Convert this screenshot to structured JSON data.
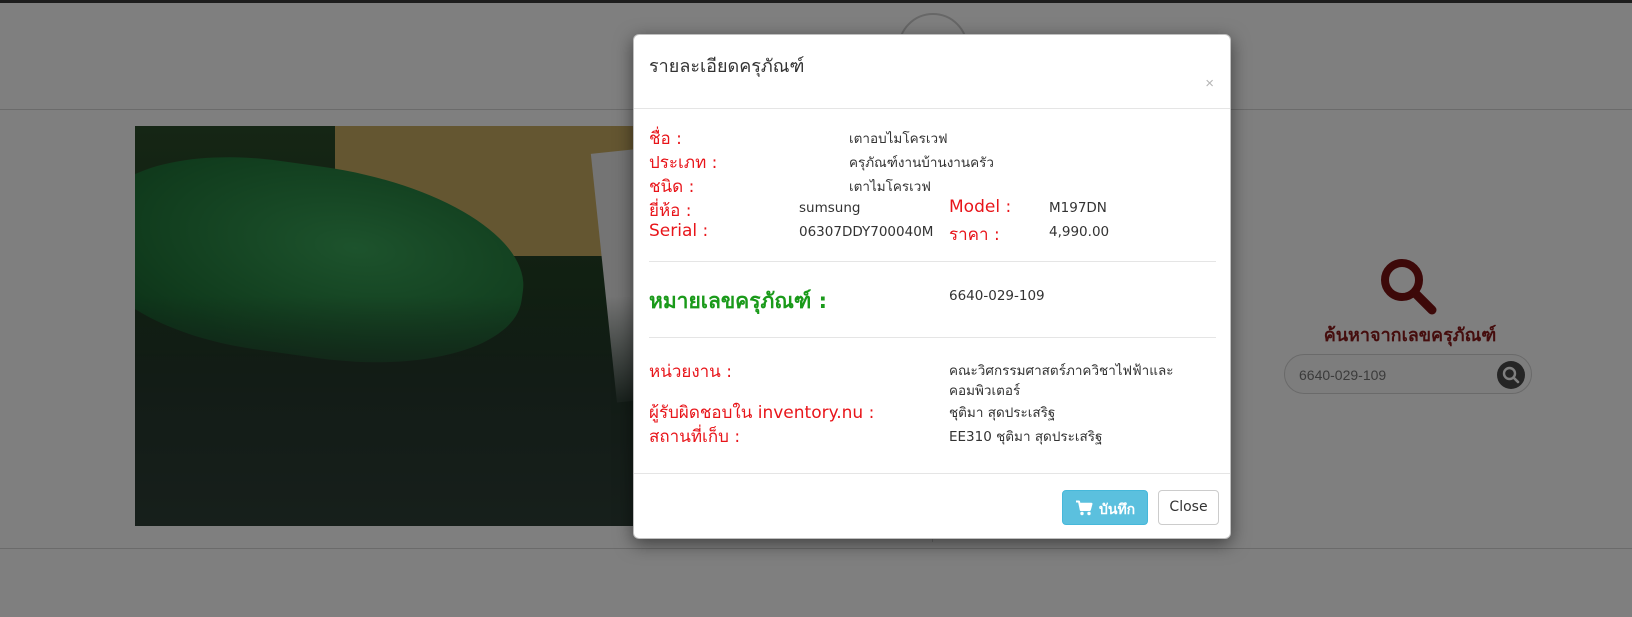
{
  "page": {
    "search_title": "ค้นหาจากเลขครุภัณฑ์",
    "search_value": "6640-029-109"
  },
  "modal": {
    "title": "รายละเอียดครุภัณฑ์",
    "close_glyph": "×",
    "fields": {
      "name_label": "ชื่อ :",
      "name_value": "เตาอบไมโครเวฟ",
      "category_label": "ประเภท :",
      "category_value": "ครุภัณฑ์งานบ้านงานครัว",
      "kind_label": "ชนิด :",
      "kind_value": "เตาไมโครเวฟ",
      "brand_label": "ยี่ห้อ :",
      "brand_value": "sumsung",
      "model_label": "Model :",
      "model_value": "M197DN",
      "serial_label": "Serial :",
      "serial_value": "06307DDY700040M",
      "price_label": "ราคา :",
      "price_value": "4,990.00",
      "asset_no_label": "หมายเลขครุภัณฑ์ :",
      "asset_no_value": "6640-029-109",
      "unit_label": "หน่วยงาน :",
      "unit_value_line1": "คณะวิศกรรมศาสตร์ภาควิชาไฟฟ้าและ",
      "unit_value_line2": "คอมพิวเตอร์",
      "owner_label": "ผู้รับผิดชอบใน inventory.nu :",
      "owner_value": "ชุติมา สุดประเสริฐ",
      "location_label": "สถานที่เก็บ :",
      "location_value": "EE310 ชุติมา สุดประเสริฐ"
    },
    "save_label": "บันทึก",
    "close_label": "Close"
  },
  "colors": {
    "label_red": "#e8151a",
    "label_green": "#1a9a1a",
    "save_button": "#5bc0de",
    "brand_dark_red": "#8a1a1a"
  },
  "icons": [
    "logo-mark",
    "search-icon",
    "cart-icon",
    "close-icon"
  ]
}
